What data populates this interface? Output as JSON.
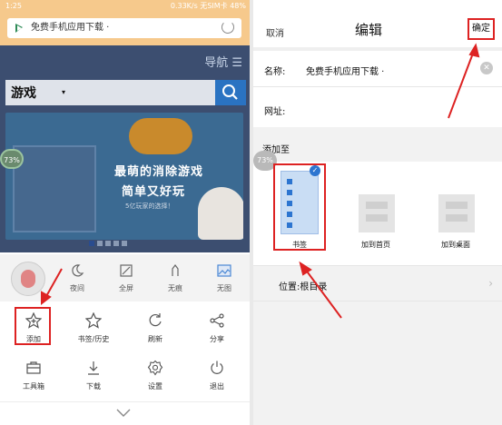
{
  "left": {
    "status": {
      "time": "1:25",
      "right": "0.33K/s 无SIM卡 48%"
    },
    "url_bar": {
      "text": "免费手机应用下载 ·"
    },
    "nav": {
      "label": "导航 ☰"
    },
    "search": {
      "category": "游戏",
      "caret": "▾"
    },
    "banner": {
      "line1": "最萌的消除游戏",
      "line2": "简单又好玩",
      "small": "5亿玩家的选择！"
    },
    "badge": "73%",
    "menu_top": [
      {
        "label": "夜间",
        "icon": "moon-icon"
      },
      {
        "label": "全屏",
        "icon": "fullscreen-icon"
      },
      {
        "label": "无痕",
        "icon": "incognito-icon"
      },
      {
        "label": "无图",
        "icon": "no-image-icon"
      }
    ],
    "menu_row1": [
      {
        "label": "添加",
        "icon": "add-bookmark-icon"
      },
      {
        "label": "书签/历史",
        "icon": "star-icon"
      },
      {
        "label": "刷新",
        "icon": "refresh-icon"
      },
      {
        "label": "分享",
        "icon": "share-icon"
      }
    ],
    "menu_row2": [
      {
        "label": "工具箱",
        "icon": "toolbox-icon"
      },
      {
        "label": "下载",
        "icon": "download-icon"
      },
      {
        "label": "设置",
        "icon": "settings-icon"
      },
      {
        "label": "退出",
        "icon": "power-icon"
      }
    ]
  },
  "right": {
    "header": {
      "cancel": "取消",
      "title": "编辑",
      "confirm": "确定"
    },
    "name": {
      "label": "名称:",
      "value": "免费手机应用下载 ·"
    },
    "url": {
      "label": "网址:"
    },
    "add_to": {
      "label": "添加至"
    },
    "badge": "73%",
    "options": [
      {
        "label": "书签",
        "selected": true
      },
      {
        "label": "加到首页",
        "selected": false
      },
      {
        "label": "加到桌面",
        "selected": false
      }
    ],
    "location": {
      "label": "位置:根目录",
      "arrow": "›"
    }
  },
  "colors": {
    "accent": "#2d75d0",
    "highlight": "#dd2222",
    "statusbar": "#f6c98c"
  }
}
